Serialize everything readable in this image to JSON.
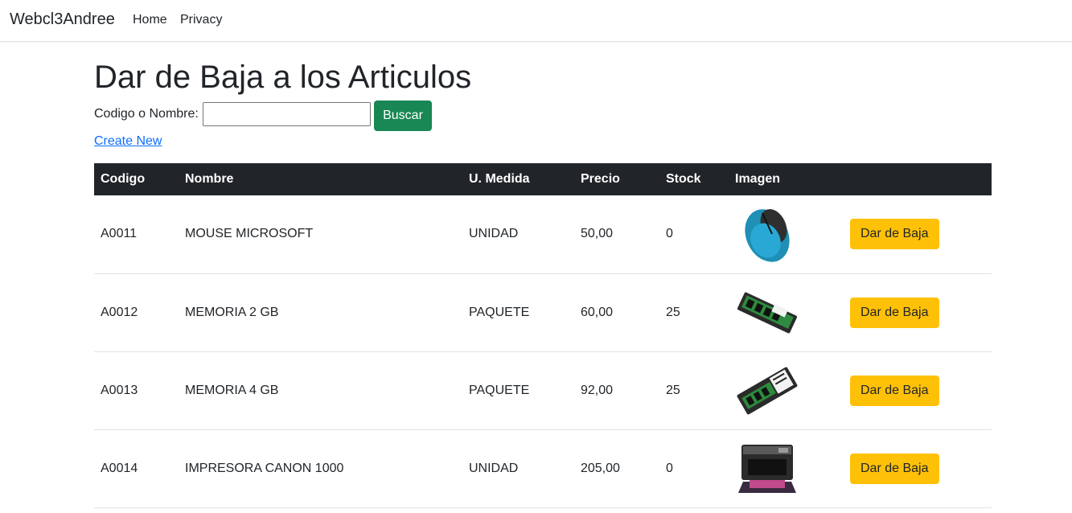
{
  "nav": {
    "brand": "Webcl3Andree",
    "links": [
      "Home",
      "Privacy"
    ]
  },
  "page": {
    "title": "Dar de Baja a los Articulos",
    "search_label": "Codigo o Nombre:",
    "search_value": "",
    "search_button": "Buscar",
    "create_link": "Create New"
  },
  "table": {
    "headers": [
      "Codigo",
      "Nombre",
      "U. Medida",
      "Precio",
      "Stock",
      "Imagen",
      ""
    ],
    "rows": [
      {
        "codigo": "A0011",
        "nombre": "MOUSE MICROSOFT",
        "medida": "UNIDAD",
        "precio": "50,00",
        "stock": "0",
        "image": "mouse-image",
        "action": "Dar de Baja"
      },
      {
        "codigo": "A0012",
        "nombre": "MEMORIA 2 GB",
        "medida": "PAQUETE",
        "precio": "60,00",
        "stock": "25",
        "image": "memory-module-image",
        "action": "Dar de Baja"
      },
      {
        "codigo": "A0013",
        "nombre": "MEMORIA 4 GB",
        "medida": "PAQUETE",
        "precio": "92,00",
        "stock": "25",
        "image": "memory-module-image",
        "action": "Dar de Baja"
      },
      {
        "codigo": "A0014",
        "nombre": "IMPRESORA CANON 1000",
        "medida": "UNIDAD",
        "precio": "205,00",
        "stock": "0",
        "image": "printer-image",
        "action": "Dar de Baja"
      }
    ]
  },
  "colors": {
    "header_bg": "#212529",
    "search_button": "#198754",
    "action_button": "#ffc107",
    "link": "#0d6efd"
  }
}
